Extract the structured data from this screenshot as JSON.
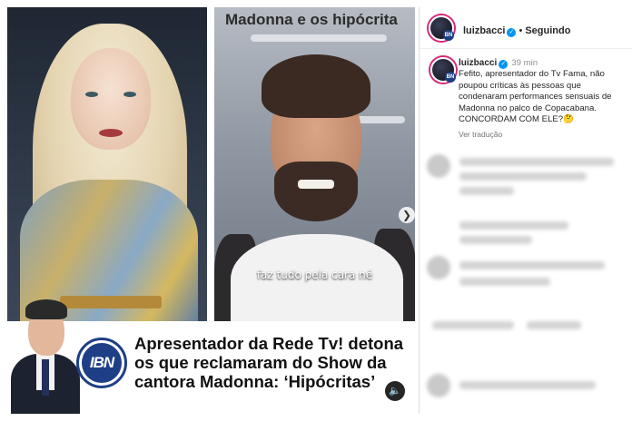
{
  "media": {
    "overlay_title": "Madonna e os hipócrita",
    "video_caption": "faz tudo pela cara né",
    "next_icon": "chevron-right-icon",
    "headline": "Apresentador da Rede Tv! detona os que reclamaram do Show da cantora Madonna: ‘Hipócritas’",
    "logo_text": "IBN",
    "mute_icon": "speaker-icon"
  },
  "post": {
    "header": {
      "username": "luizbacci",
      "verified_icon": "verified-badge-icon",
      "separator": "•",
      "follow_status": "Seguindo",
      "avatar_badge": "BN"
    },
    "caption": {
      "username": "luizbacci",
      "time": "39 min",
      "text": "Fefito, apresentador do Tv Fama, não poupou críticas às pessoas que condenaram performances sensuais de Madonna no palco de Copacabana. CONCORDAM COM ELE?🤔",
      "translate_label": "Ver tradução"
    }
  },
  "colors": {
    "verified": "#0095f6",
    "brand_blue": "#1e3f86",
    "story_ring": "#d62976"
  }
}
